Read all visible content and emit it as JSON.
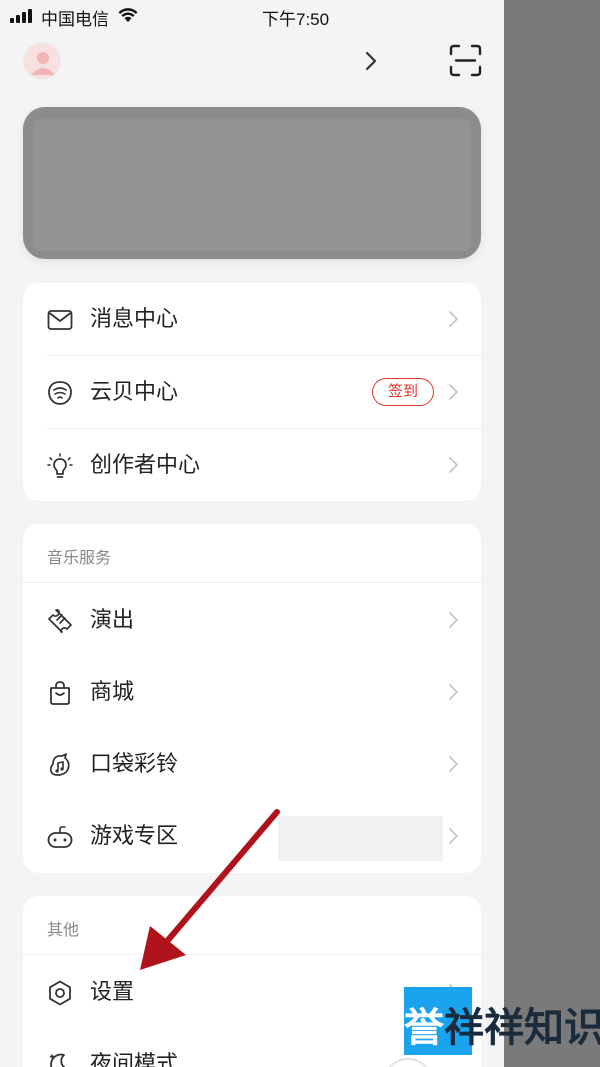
{
  "status_bar": {
    "carrier": "中国电信",
    "time": "下午7:50"
  },
  "header": {
    "avatar_icon": "avatar-icon",
    "scan_icon": "scan-icon"
  },
  "card1": {
    "items": [
      {
        "label": "消息中心",
        "icon": "mail-icon"
      },
      {
        "label": "云贝中心",
        "icon": "cloud-shell-icon",
        "badge": "签到"
      },
      {
        "label": "创作者中心",
        "icon": "lightbulb-icon"
      }
    ]
  },
  "music_services": {
    "title": "音乐服务",
    "items": [
      {
        "label": "演出",
        "icon": "ticket-icon"
      },
      {
        "label": "商城",
        "icon": "shopping-bag-icon"
      },
      {
        "label": "口袋彩铃",
        "icon": "ringtone-icon"
      },
      {
        "label": "游戏专区",
        "icon": "gamepad-icon"
      }
    ]
  },
  "other": {
    "title": "其他",
    "items": [
      {
        "label": "设置",
        "icon": "settings-icon"
      },
      {
        "label": "夜间模式",
        "icon": "moon-icon"
      }
    ]
  },
  "watermark": {
    "text": "誉祥祥知识"
  },
  "colors": {
    "accent": "#e0352b",
    "annotation_arrow": "#b0121b",
    "watermark_blue": "#1aa3ee"
  }
}
